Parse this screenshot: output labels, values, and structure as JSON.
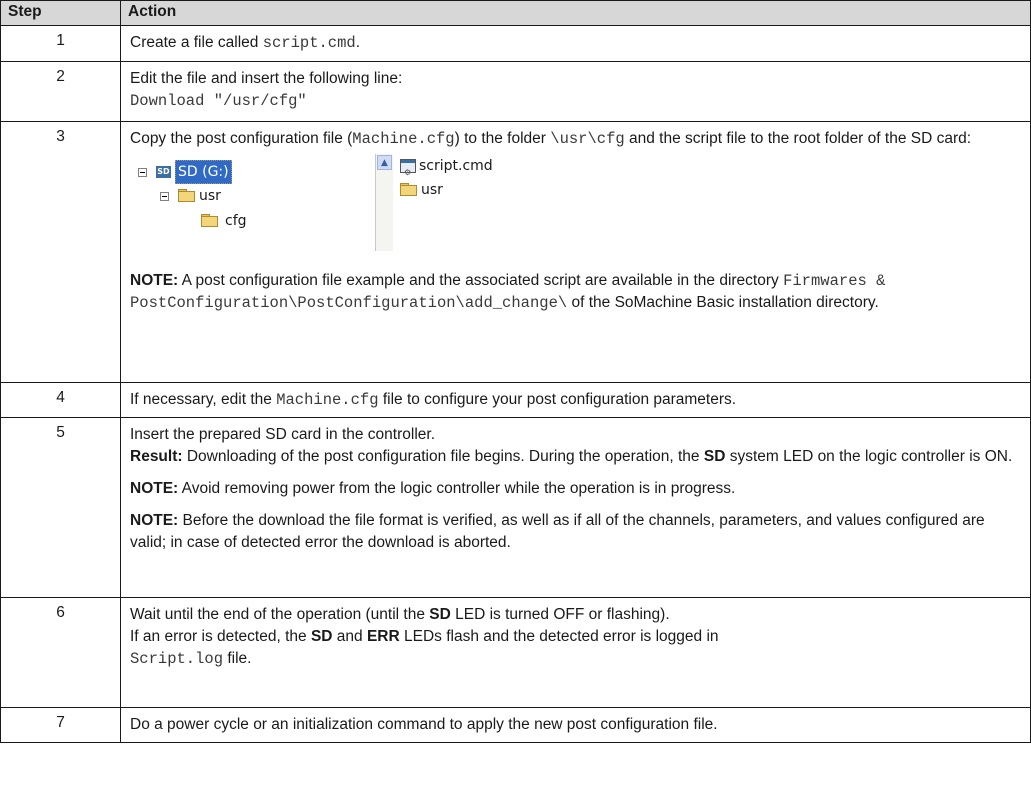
{
  "table": {
    "header": {
      "step": "Step",
      "action": "Action"
    },
    "rows": [
      {
        "step": "1",
        "text_a": "Create a file called ",
        "code_a": "script.cmd",
        "text_b": "."
      },
      {
        "step": "2",
        "text_a": "Edit the file and insert the following line:",
        "code_a": "Download \"/usr/cfg\""
      },
      {
        "step": "3",
        "text_a": "Copy the post configuration file (",
        "code_a": "Machine.cfg",
        "text_b": ") to the folder ",
        "code_b": "\\usr\\cfg",
        "text_c": " and the script file to the root folder of the SD card:",
        "tree": {
          "drive": "SD (G:)",
          "drive_icon_text": "SD",
          "folder_usr": "usr",
          "folder_cfg": "cfg",
          "file_script": "script.cmd",
          "right_folder_usr": "usr"
        },
        "note_label": "NOTE:",
        "note_text_a": " A post configuration file example and the associated script are available in the directory ",
        "note_code": "Firmwares & PostConfiguration\\PostConfiguration\\add_change\\",
        "note_text_b": " of the SoMachine Basic installation directory."
      },
      {
        "step": "4",
        "text_a": "If necessary, edit the ",
        "code_a": "Machine.cfg",
        "text_b": " file to configure your post configuration parameters."
      },
      {
        "step": "5",
        "text_a": "Insert the prepared SD card in the controller.",
        "result_label": "Result:",
        "result_text_a": " Downloading of the post configuration file begins. During the operation, the ",
        "result_bold": "SD",
        "result_text_b": " system LED on the logic controller is ON.",
        "note1_label": "NOTE:",
        "note1_text": " Avoid removing power from the logic controller while the operation is in progress.",
        "note2_label": "NOTE:",
        "note2_text": " Before the download the file format is verified, as well as if all of the channels, parameters, and values configured are valid; in case of detected error the download is aborted."
      },
      {
        "step": "6",
        "text_a": "Wait until the end of the operation (until the ",
        "bold_a": "SD",
        "text_b": " LED is turned OFF or flashing).",
        "text_c": "If an error is detected, the ",
        "bold_b": "SD",
        "text_d": " and ",
        "bold_c": "ERR",
        "text_e": " LEDs flash and the detected error is logged in",
        "code_a": "Script.log",
        "text_f": " file."
      },
      {
        "step": "7",
        "text_a": "Do a power cycle or an initialization command to apply the new post configuration file."
      }
    ]
  }
}
